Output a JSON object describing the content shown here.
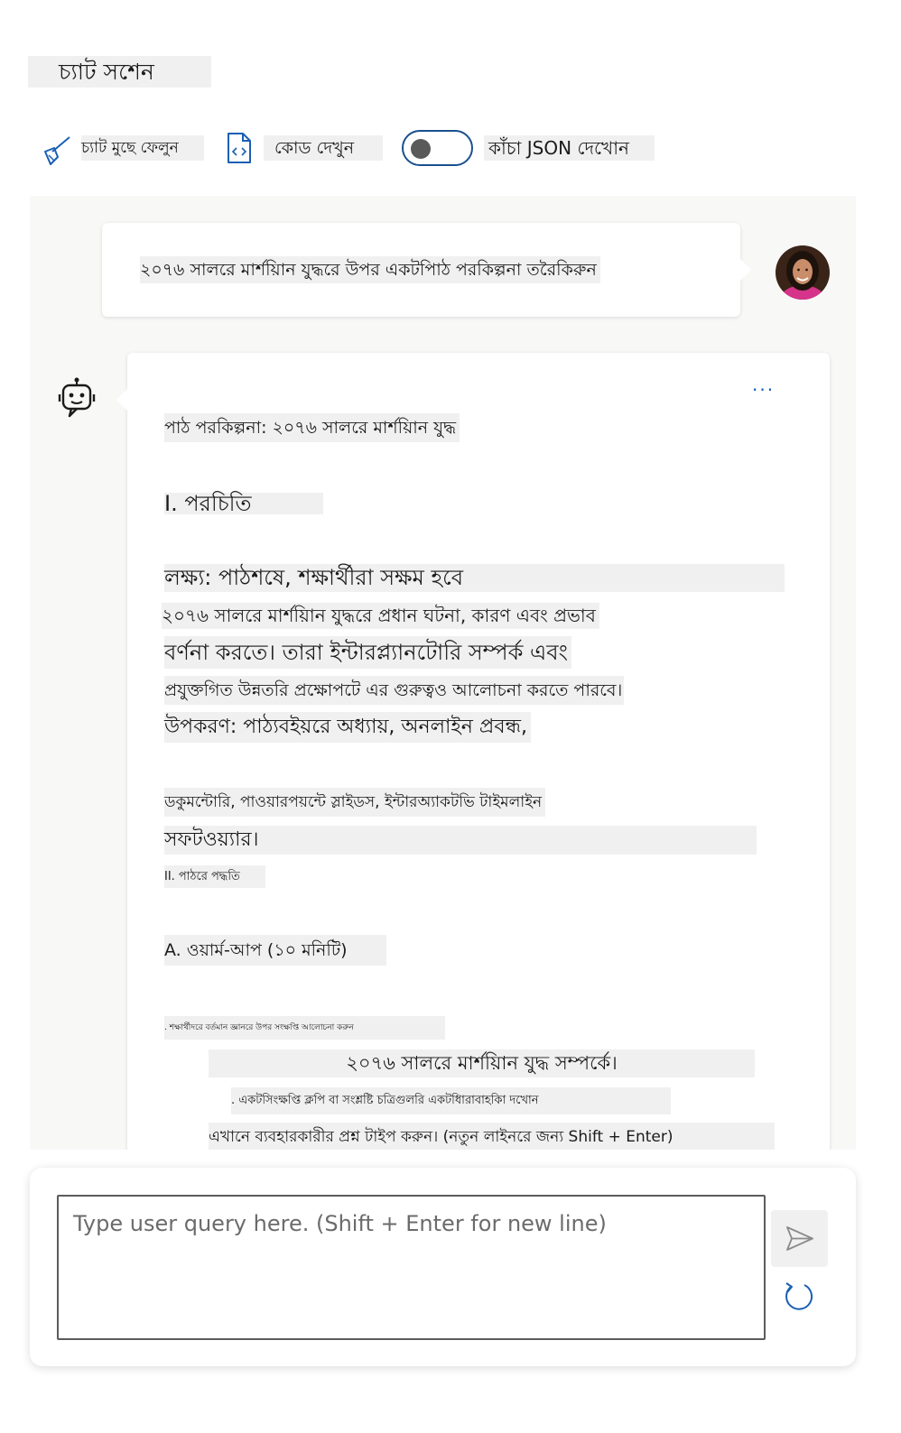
{
  "session": {
    "title": "চ্যাট সশেন"
  },
  "toolbar": {
    "clear_chat_label": "চ্যাট মুছে ফেলুন",
    "view_code_label": "কোড দেখুন",
    "raw_json_label": "কাঁচা JSON দেখোন",
    "raw_json_toggle": "off"
  },
  "conversation": {
    "user_message": "২০৭৬ সালরে মার্শয়িান যুদ্ধরে উপর একটপিাঠ পরকিল্পনা তরৈকিরুন",
    "assistant_more_label": "...",
    "assistant_lines": [
      "পাঠ পরকিল্পনা: ২০৭৬ সালরে মার্শয়িান যুদ্ধ",
      "I. পরচিতি",
      "লক্ষ্য: পাঠশষে, শক্ষার্থীরা সক্ষম হবে",
      "২০৭৬ সালরে মার্শয়িান যুদ্ধরে প্রধান ঘটনা, কারণ এবং প্রভাব",
      "বর্ণনা করতে। তারা ইন্টারপ্ল্যানটোরি সম্পর্ক এবং",
      "প্রযুক্তগিত উন্নতরি প্রক্ষোপটে এর গুরুত্বও আলোচনা করতে পারবে।",
      "উপকরণ: পাঠ্যবইয়রে অধ্যায়, অনলাইন প্রবন্ধ,",
      "ডকুমন্টোরি, পাওয়ারপয়ন্টে স্লাইডস, ইন্টারঅ্যাকটভি টাইমলাইন",
      "সফটওয়্যার।",
      "II. পাঠরে পদ্ধতি",
      "A. ওয়ার্ম-আপ (১০ মনিটি)",
      ". শক্ষার্থীদরে বর্তমান জ্ঞানরে উপর সংক্ষপ্তি আলোচনা করুন",
      "২০৭৬ সালরে মার্শয়িান যুদ্ধ সম্পর্কে।",
      ". একটসিংক্ষপ্তি ক্লপি বা সংশ্লষ্টি চত্রিগুলরি একটধিারাবাহকিা দখোন",
      "এখানে ব্যবহারকারীর প্রশ্ন টাইপ করুন। (নতুন লাইনরে জন্য Shift + Enter)"
    ]
  },
  "composer": {
    "placeholder": "Type user query here. (Shift + Enter for new line)",
    "value": ""
  },
  "icons": {
    "clear_chat": "broom-icon",
    "view_code": "code-file-icon",
    "send": "send-icon",
    "refresh": "refresh-icon",
    "assistant": "bot-icon"
  },
  "colors": {
    "accent": "#1a5fb4",
    "toggle_border": "#1a4f8f",
    "highlight": "#f0f0f0",
    "chat_background": "#f8f8f7"
  }
}
